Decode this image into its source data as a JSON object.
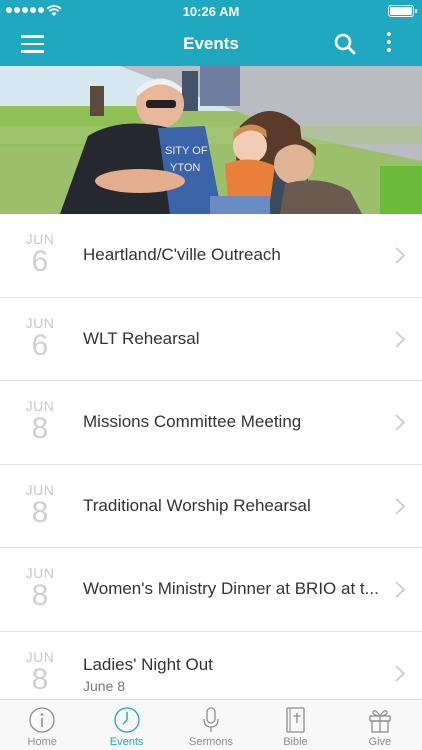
{
  "status_bar": {
    "time": "10:26 AM"
  },
  "nav": {
    "title": "Events"
  },
  "events": [
    {
      "month": "JUN",
      "day": "6",
      "title": "Heartland/C'ville Outreach",
      "subtitle": ""
    },
    {
      "month": "JUN",
      "day": "6",
      "title": "WLT Rehearsal",
      "subtitle": ""
    },
    {
      "month": "JUN",
      "day": "8",
      "title": "Missions Committee Meeting",
      "subtitle": ""
    },
    {
      "month": "JUN",
      "day": "8",
      "title": "Traditional Worship Rehearsal",
      "subtitle": ""
    },
    {
      "month": "JUN",
      "day": "8",
      "title": "Women's Ministry Dinner at BRIO at t...",
      "subtitle": ""
    },
    {
      "month": "JUN",
      "day": "8",
      "title": "Ladies' Night Out",
      "subtitle": "June 8"
    }
  ],
  "tabs": [
    {
      "label": "Home",
      "icon": "info-icon",
      "active": false
    },
    {
      "label": "Events",
      "icon": "clock-icon",
      "active": true
    },
    {
      "label": "Sermons",
      "icon": "microphone-icon",
      "active": false
    },
    {
      "label": "Bible",
      "icon": "bible-icon",
      "active": false
    },
    {
      "label": "Give",
      "icon": "gift-icon",
      "active": false
    }
  ],
  "colors": {
    "accent": "#1fa8bf",
    "tab_inactive": "#8e8e93",
    "date_gray": "#c8c8c8"
  }
}
